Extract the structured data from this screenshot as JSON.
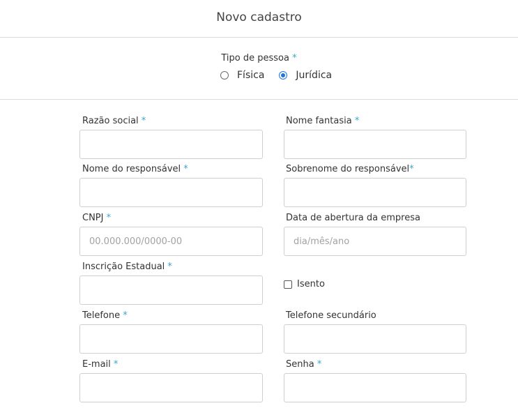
{
  "header": {
    "title": "Novo cadastro"
  },
  "person_type": {
    "label": "Tipo de pessoa",
    "required_mark": "*",
    "options": [
      {
        "label": "Física",
        "checked": false
      },
      {
        "label": "Jurídica",
        "checked": true
      }
    ]
  },
  "form": {
    "razao_social": {
      "label": "Razão social",
      "required_mark": "*",
      "value": "",
      "placeholder": ""
    },
    "nome_fantasia": {
      "label": "Nome fantasia",
      "required_mark": "*",
      "value": "",
      "placeholder": ""
    },
    "nome_responsavel": {
      "label": "Nome do responsável",
      "required_mark": "*",
      "value": "",
      "placeholder": ""
    },
    "sobrenome_responsavel": {
      "label": "Sobrenome do responsável",
      "required_mark": "*",
      "value": "",
      "placeholder": ""
    },
    "cnpj": {
      "label": "CNPJ",
      "required_mark": "*",
      "value": "",
      "placeholder": "00.000.000/0000-00"
    },
    "data_abertura": {
      "label": "Data de abertura da empresa",
      "value": "",
      "placeholder": "dia/mês/ano"
    },
    "inscricao_estadual": {
      "label": "Inscrição Estadual",
      "required_mark": "*",
      "value": "",
      "placeholder": ""
    },
    "isento": {
      "label": "Isento",
      "checked": false
    },
    "telefone": {
      "label": "Telefone",
      "required_mark": "*",
      "value": "",
      "placeholder": ""
    },
    "telefone_secundario": {
      "label": "Telefone secundário",
      "value": "",
      "placeholder": ""
    },
    "email": {
      "label": "E-mail",
      "required_mark": "*",
      "value": "",
      "placeholder": ""
    },
    "senha": {
      "label": "Senha",
      "required_mark": "*",
      "value": "",
      "placeholder": ""
    }
  },
  "colors": {
    "accent": "#3aa5c9",
    "radio_checked": "#1f74e0",
    "border": "#cfcfcf"
  }
}
